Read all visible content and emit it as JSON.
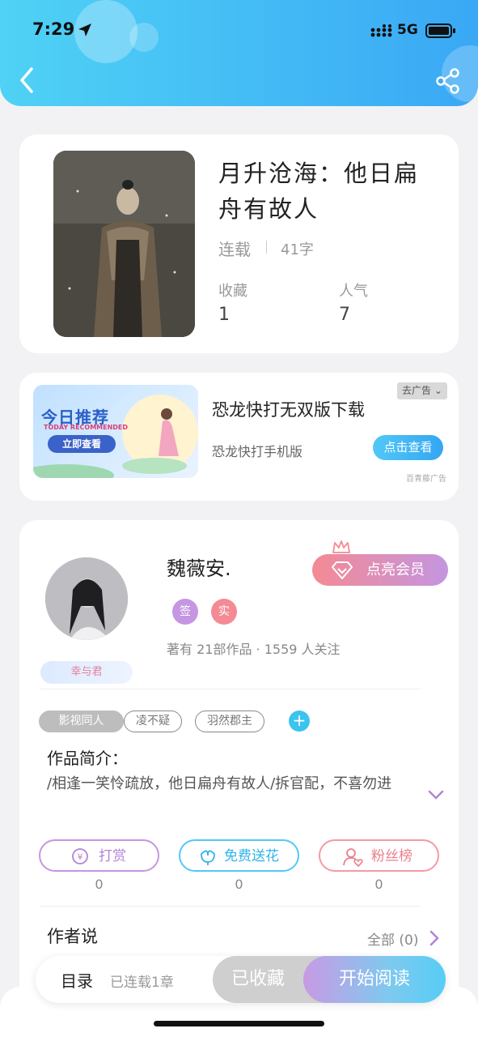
{
  "status_bar": {
    "time": "7:29",
    "network": "5G"
  },
  "book": {
    "title": "月升沧海：他日扁舟有故人",
    "status": "连载",
    "word_count": "41字",
    "favorites_label": "收藏",
    "favorites_value": "1",
    "popularity_label": "人气",
    "popularity_value": "7"
  },
  "ad": {
    "banner_title": "今日推荐",
    "banner_subtitle": "TODAY RECOMMENDED",
    "banner_button": "立即查看",
    "close_label": "去广告",
    "title": "恐龙快打无双版下载",
    "description": "恐龙快打手机版",
    "button": "点击查看",
    "source": "百青藤广告"
  },
  "author": {
    "name": "魏薇安.",
    "fan_tag": "幸与君",
    "vip_button": "点亮会员",
    "badge_sign": "签",
    "badge_real": "实",
    "stats": "著有 21部作品 · 1559 人关注"
  },
  "tags": [
    "影视同人",
    "凌不疑",
    "羽然郡主"
  ],
  "intro": {
    "title": "作品简介：",
    "text": "/相逢一笑怜疏放，他日扁舟有故人/拆官配，不喜勿进"
  },
  "actions": {
    "reward_label": "打赏",
    "reward_count": "0",
    "flower_label": "免费送花",
    "flower_count": "0",
    "fans_label": "粉丝榜",
    "fans_count": "0"
  },
  "author_says": {
    "title": "作者说",
    "all_label": "全部 (0)"
  },
  "bottom": {
    "toc_label": "目录",
    "toc_count": "已连载1章",
    "collected_label": "已收藏",
    "read_label": "开始阅读"
  },
  "colors": {
    "header_start": "#4fd2f5",
    "header_end": "#3aa8f5",
    "vip_start": "#f48a94",
    "vip_end": "#c495e0"
  }
}
